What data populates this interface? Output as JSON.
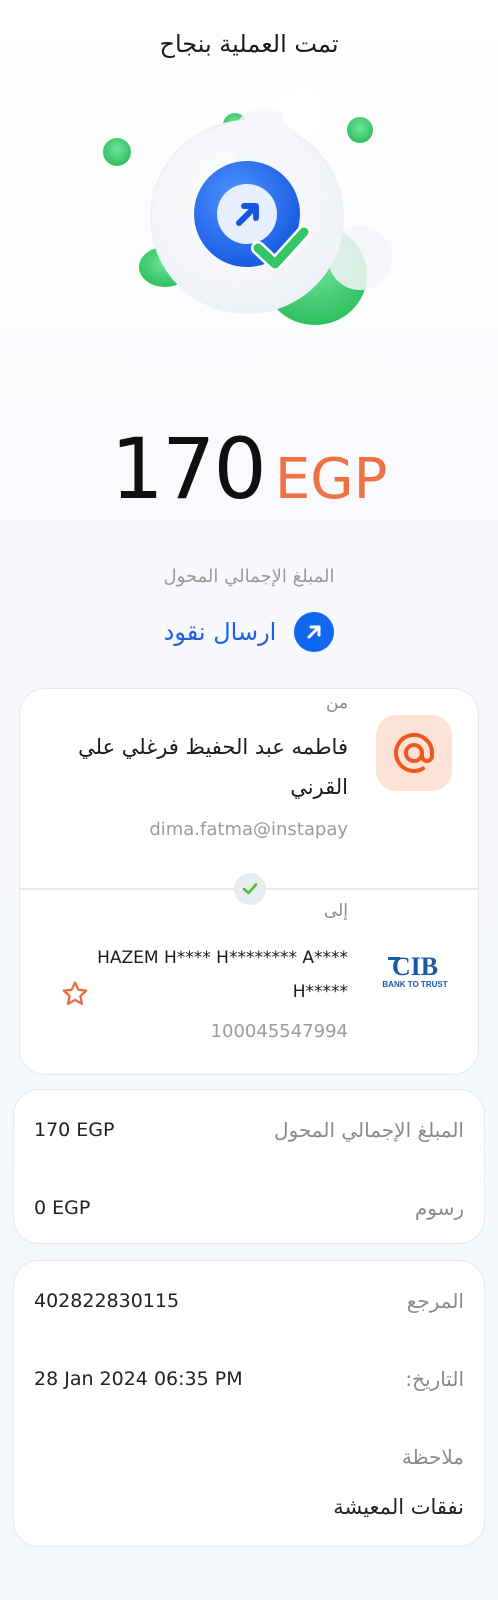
{
  "header": {
    "title": "تمت العملية بنجاح"
  },
  "amount": {
    "value": "170",
    "currency": "EGP",
    "label": "المبلغ الإجمالي المحول"
  },
  "transfer_type": {
    "label": "ارسال نقود",
    "icon": "arrow-up-right-icon"
  },
  "from": {
    "label": "من",
    "name_line1": "فاطمه عبد الحفيظ  فرغلي علي",
    "name_line2": "القرني",
    "address": "dima.fatma@instapay",
    "icon": "at-sign-icon"
  },
  "to": {
    "label": "إلى",
    "name_line1": "HAZEM H**** H******** A****",
    "name_line2": "H*****",
    "account": "100045547994",
    "bank_logo_text": "CIB",
    "bank_tagline": "BANK TO TRUST"
  },
  "summary": {
    "rows": [
      {
        "key": "المبلغ الإجمالي المحول",
        "value": "170 EGP"
      },
      {
        "key": "رسوم",
        "value": "0 EGP"
      }
    ]
  },
  "details": {
    "reference_label": "المرجع",
    "reference_value": "402822830115",
    "date_label": "التاريخ:",
    "date_value": "28 Jan 2024 06:35 PM",
    "note_label": "ملاحظة",
    "note_value": "نفقات المعيشة"
  },
  "colors": {
    "accent_blue": "#1168f0",
    "accent_orange": "#f07142",
    "success_green": "#3ccf6e"
  }
}
